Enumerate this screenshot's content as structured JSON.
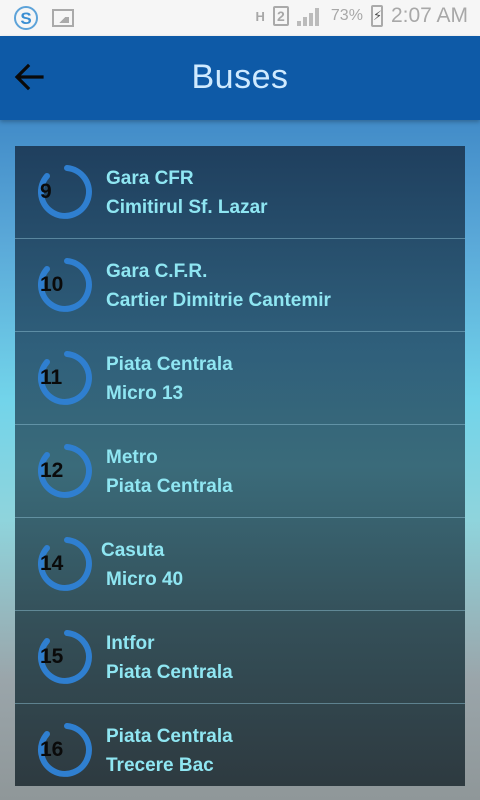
{
  "status_bar": {
    "time": "2:07 AM",
    "battery_percent": "73%",
    "network_label": "H",
    "sim_slot": "2",
    "icons": [
      "app-s-icon",
      "image-icon",
      "signal-icon",
      "battery-charging-icon"
    ]
  },
  "appbar": {
    "title": "Buses",
    "back_icon": "arrow-left-icon"
  },
  "routes": [
    {
      "number": "9",
      "from": "Gara CFR",
      "to": "Cimitirul Sf. Lazar"
    },
    {
      "number": "10",
      "from": "Gara C.F.R.",
      "to": "Cartier Dimitrie Cantemir"
    },
    {
      "number": "11",
      "from": "Piata Centrala",
      "to": "Micro 13"
    },
    {
      "number": "12",
      "from": "Metro",
      "to": "Piata Centrala"
    },
    {
      "number": "14",
      "from": "Casuta",
      "to": "Micro 40"
    },
    {
      "number": "15",
      "from": "Intfor",
      "to": "Piata Centrala"
    },
    {
      "number": "16",
      "from": "Piata Centrala",
      "to": "Trecere Bac"
    }
  ],
  "colors": {
    "appbar": "#0e5aa7",
    "route_text": "#8fe6f2",
    "badge_ring": "#2f7fd0"
  }
}
